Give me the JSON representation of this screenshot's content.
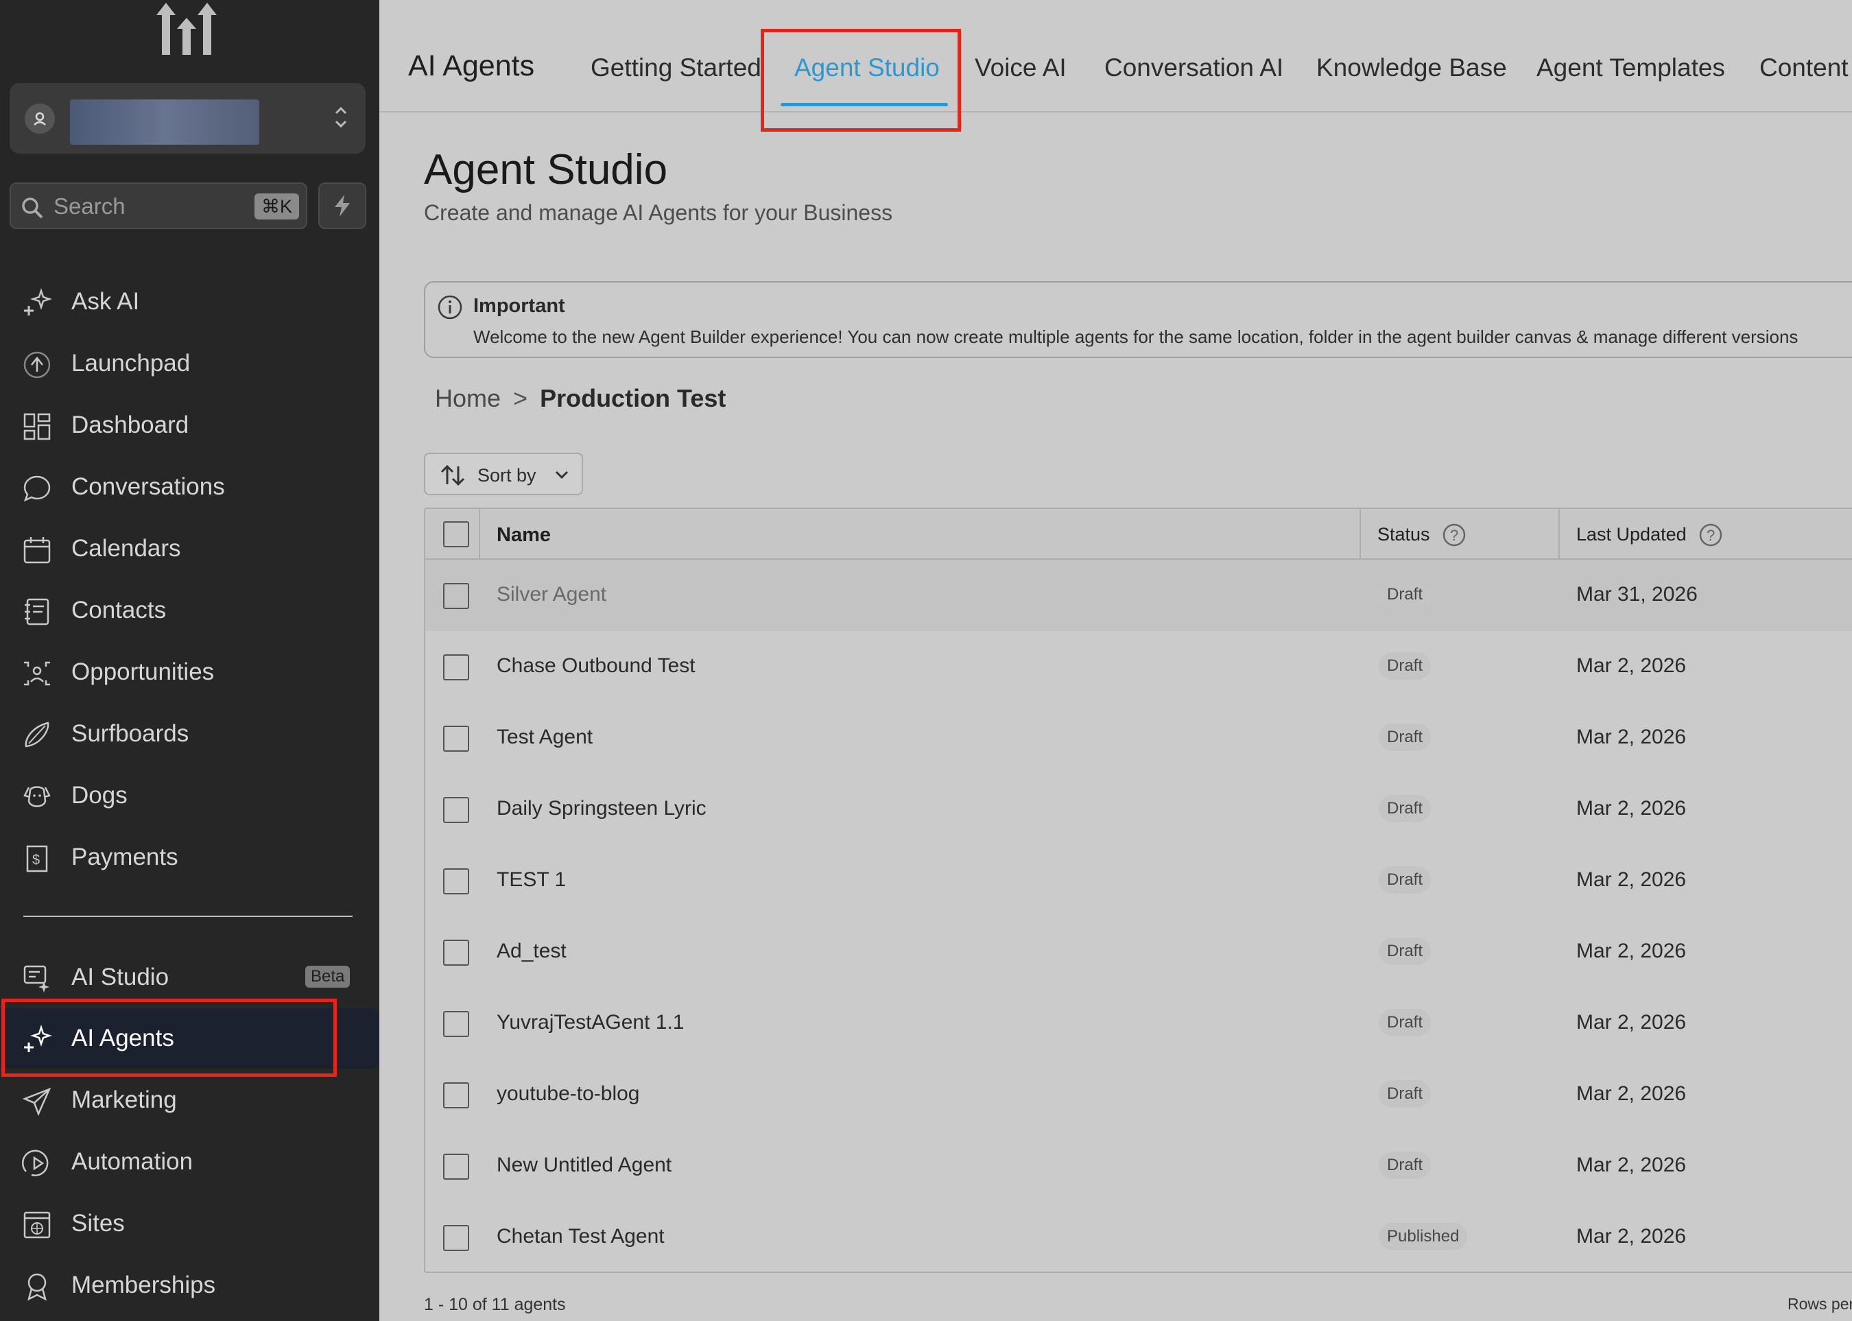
{
  "sidebar": {
    "search": {
      "placeholder": "Search",
      "shortcut": "⌘K"
    },
    "items": [
      {
        "label": "Ask AI",
        "icon": "sparkle-icon"
      },
      {
        "label": "Launchpad",
        "icon": "rocket-icon"
      },
      {
        "label": "Dashboard",
        "icon": "dashboard-icon"
      },
      {
        "label": "Conversations",
        "icon": "chat-bubble-icon"
      },
      {
        "label": "Calendars",
        "icon": "calendar-icon"
      },
      {
        "label": "Contacts",
        "icon": "contacts-icon"
      },
      {
        "label": "Opportunities",
        "icon": "opportunities-icon"
      },
      {
        "label": "Surfboards",
        "icon": "surfboard-icon"
      },
      {
        "label": "Dogs",
        "icon": "dog-icon"
      },
      {
        "label": "Payments",
        "icon": "payments-icon"
      },
      {
        "label": "AI Studio",
        "icon": "ai-studio-icon",
        "badge": "Beta"
      },
      {
        "label": "AI Agents",
        "icon": "sparkle-icon",
        "active": true
      },
      {
        "label": "Marketing",
        "icon": "send-icon"
      },
      {
        "label": "Automation",
        "icon": "automation-icon"
      },
      {
        "label": "Sites",
        "icon": "sites-icon"
      },
      {
        "label": "Memberships",
        "icon": "badge-icon"
      }
    ]
  },
  "header": {
    "title": "AI Agents",
    "tabs": [
      "Getting Started",
      "Agent Studio",
      "Voice AI",
      "Conversation AI",
      "Knowledge Base",
      "Agent Templates",
      "Content AI"
    ],
    "active_tab": "Agent Studio"
  },
  "main": {
    "title": "Agent Studio",
    "subtitle": "Create and manage AI Agents for your Business",
    "notice": {
      "title": "Important",
      "text": "Welcome to the new Agent Builder experience! You can now create multiple agents for the same location, folder in the agent builder canvas & manage different versions"
    },
    "breadcrumb": {
      "home": "Home",
      "separator": ">",
      "current": "Production Test"
    },
    "sort_label": "Sort by",
    "table": {
      "columns": [
        "Name",
        "Status",
        "Last Updated"
      ],
      "rows": [
        {
          "name": "Silver Agent",
          "status": "Draft",
          "updated": "Mar 31, 2026"
        },
        {
          "name": "Chase Outbound Test",
          "status": "Draft",
          "updated": "Mar 2, 2026"
        },
        {
          "name": "Test Agent",
          "status": "Draft",
          "updated": "Mar 2, 2026"
        },
        {
          "name": "Daily Springsteen Lyric",
          "status": "Draft",
          "updated": "Mar 2, 2026"
        },
        {
          "name": "TEST 1",
          "status": "Draft",
          "updated": "Mar 2, 2026"
        },
        {
          "name": "Ad_test",
          "status": "Draft",
          "updated": "Mar 2, 2026"
        },
        {
          "name": "YuvrajTestAGent 1.1",
          "status": "Draft",
          "updated": "Mar 2, 2026"
        },
        {
          "name": "youtube-to-blog",
          "status": "Draft",
          "updated": "Mar 2, 2026"
        },
        {
          "name": "New Untitled Agent",
          "status": "Draft",
          "updated": "Mar 2, 2026"
        },
        {
          "name": "Chetan Test Agent",
          "status": "Published",
          "updated": "Mar 2, 2026"
        }
      ]
    },
    "footer": {
      "count": "1 - 10 of 11 agents",
      "rows_per_page": "Rows per page"
    }
  },
  "colors": {
    "accent": "#2f97cf",
    "highlight": "#e4251b",
    "sidebar_bg": "#262626"
  }
}
